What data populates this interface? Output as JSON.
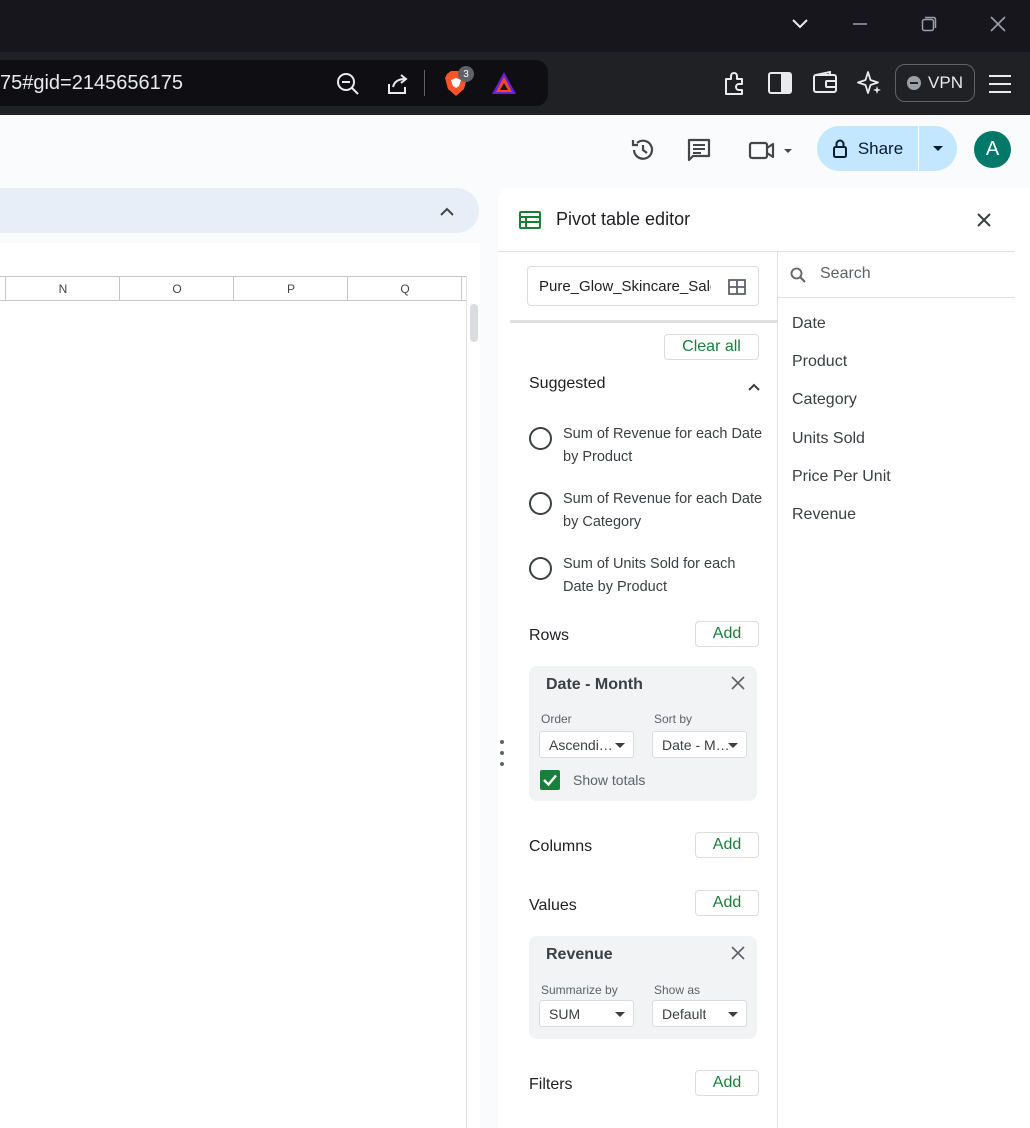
{
  "browser": {
    "url_fragment": "75#gid=2145656175",
    "brave_badge": "3",
    "vpn_label": "VPN"
  },
  "header": {
    "share_label": "Share",
    "avatar_letter": "A"
  },
  "sheet": {
    "columns": [
      "N",
      "O",
      "P",
      "Q"
    ]
  },
  "pivot": {
    "title": "Pivot table editor",
    "range": "Pure_Glow_Skincare_Sales",
    "clear_all": "Clear all",
    "suggested": {
      "label": "Suggested",
      "items": [
        "Sum of Revenue for each Date by Product",
        "Sum of Revenue for each Date by Category",
        "Sum of Units Sold for each Date by Product"
      ]
    },
    "add_label": "Add",
    "rows": {
      "label": "Rows",
      "card": {
        "title": "Date - Month",
        "order_label": "Order",
        "order_value": "Ascendi…",
        "sortby_label": "Sort by",
        "sortby_value": "Date - M…",
        "show_totals": "Show totals"
      }
    },
    "columns_label": "Columns",
    "values": {
      "label": "Values",
      "card": {
        "title": "Revenue",
        "summarize_label": "Summarize by",
        "summarize_value": "SUM",
        "showas_label": "Show as",
        "showas_value": "Default"
      }
    },
    "filters_label": "Filters",
    "search_placeholder": "Search",
    "fields": [
      "Date",
      "Product",
      "Category",
      "Units Sold",
      "Price Per Unit",
      "Revenue"
    ]
  },
  "colors": {
    "accent_green": "#188038",
    "share_bg": "#c2e7ff",
    "avatar_bg": "#00796b"
  }
}
